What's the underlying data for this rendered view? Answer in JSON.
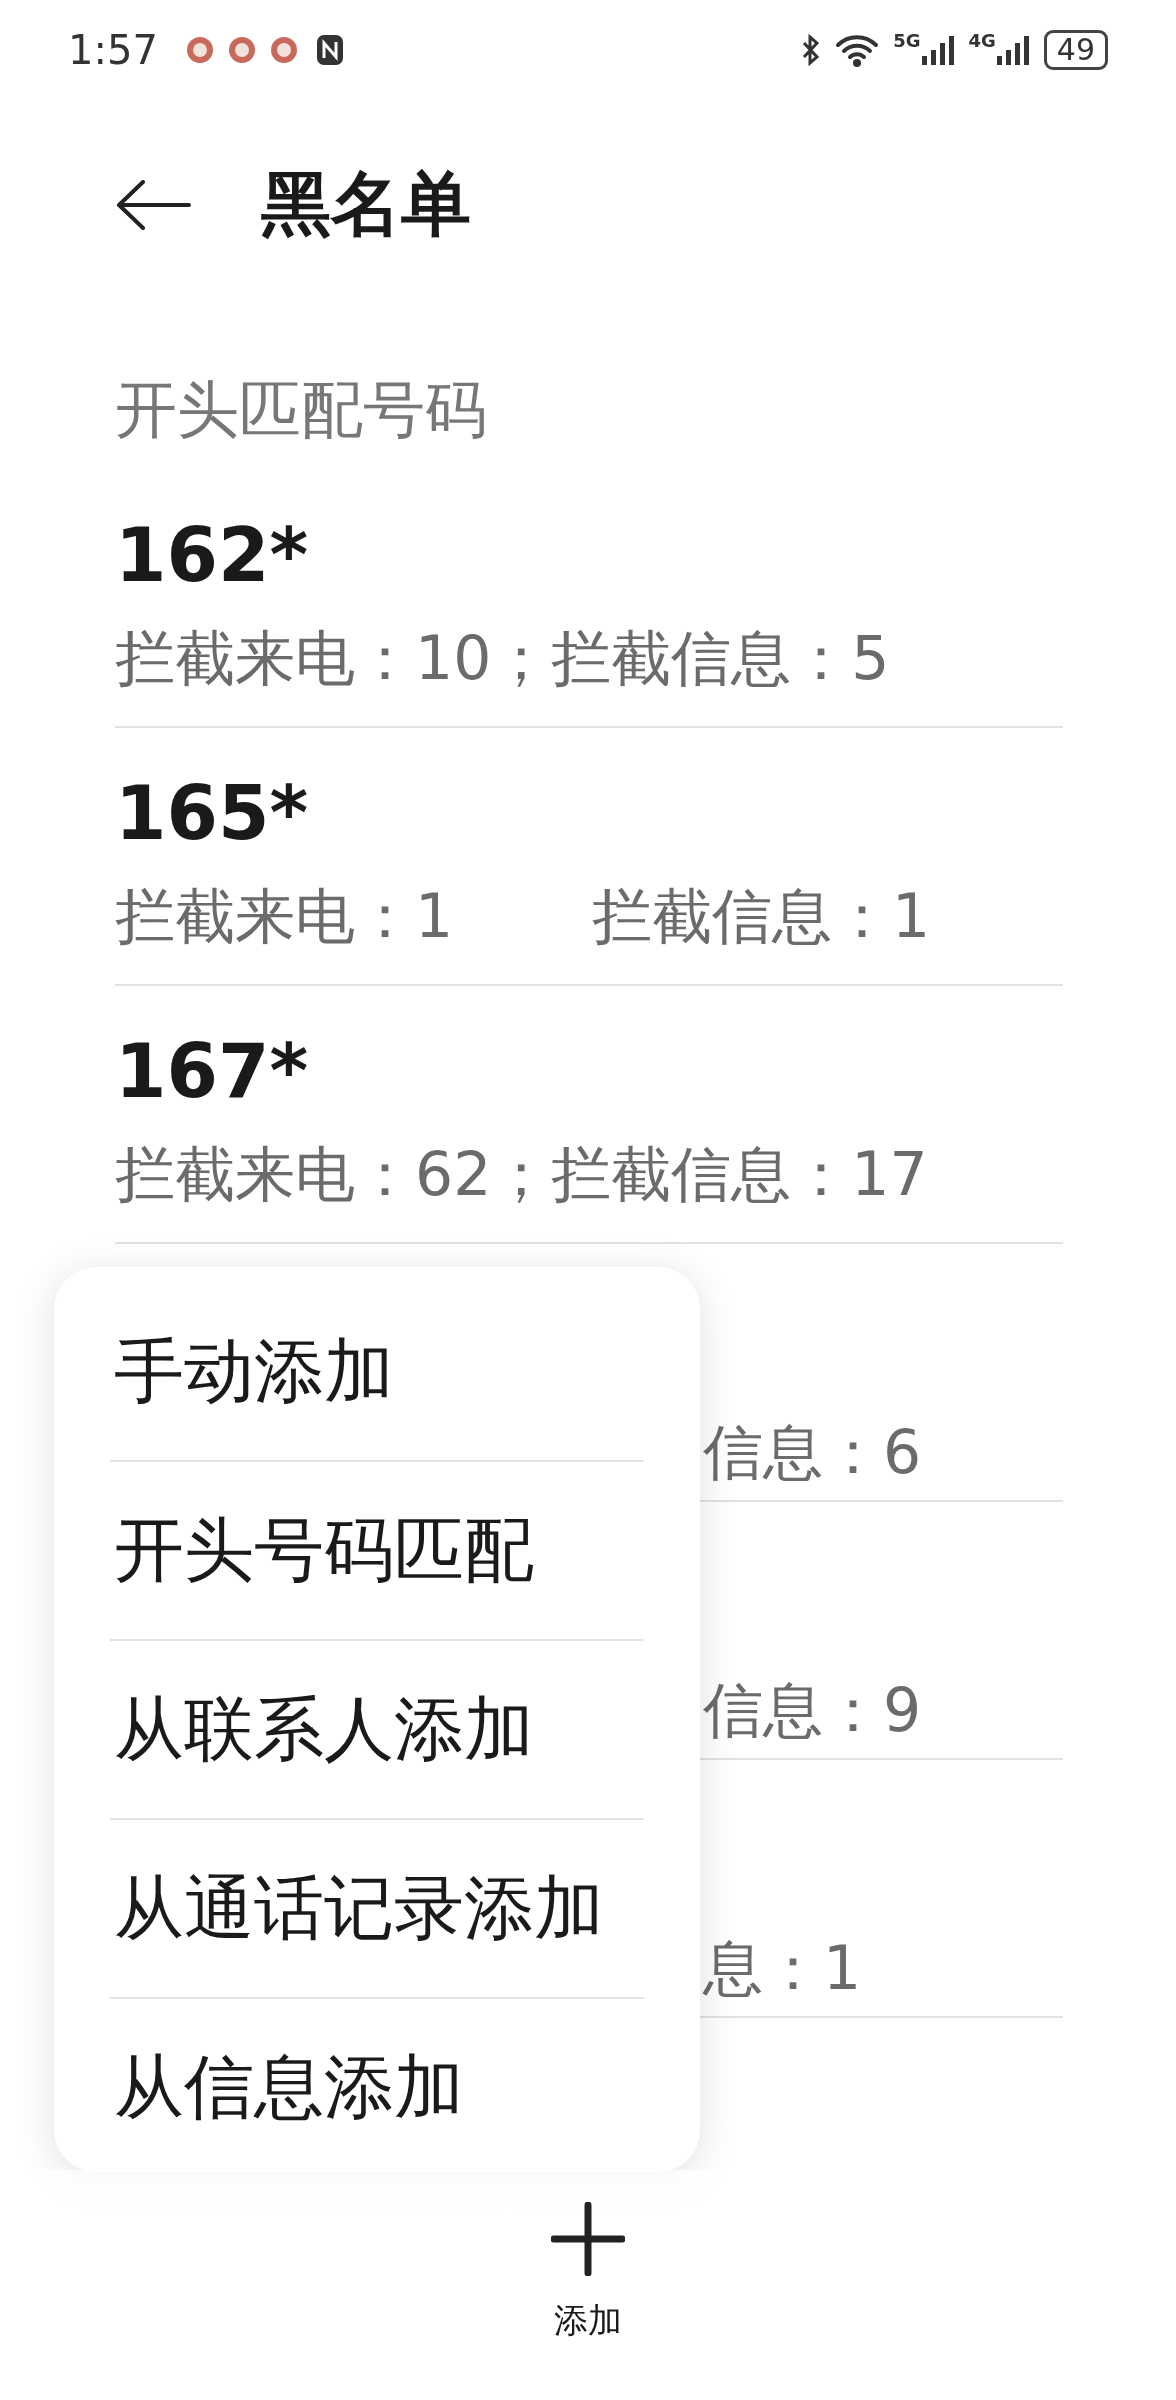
{
  "status_bar": {
    "time": "1:57",
    "network_1": "5G",
    "network_2": "4G",
    "battery": "49"
  },
  "header": {
    "title": "黑名单"
  },
  "section": {
    "title": "开头匹配号码"
  },
  "entries": [
    {
      "kind": "full",
      "number": "162*",
      "stats": [
        "拦截来电：10；拦截信息：5"
      ]
    },
    {
      "kind": "full",
      "number": "165*",
      "stats": [
        "拦截来电：1",
        "拦截信息：1"
      ]
    },
    {
      "kind": "full",
      "number": "167*",
      "stats": [
        "拦截来电：62；拦截信息：17"
      ]
    },
    {
      "kind": "covered",
      "stats": [
        "信息：6"
      ]
    },
    {
      "kind": "covered",
      "stats": [
        "信息：9"
      ]
    },
    {
      "kind": "covered",
      "stats": [
        "息：1"
      ]
    }
  ],
  "menu": {
    "items": [
      "手动添加",
      "开头号码匹配",
      "从联系人添加",
      "从通话记录添加",
      "从信息添加"
    ]
  },
  "add_button": {
    "label": "添加"
  }
}
